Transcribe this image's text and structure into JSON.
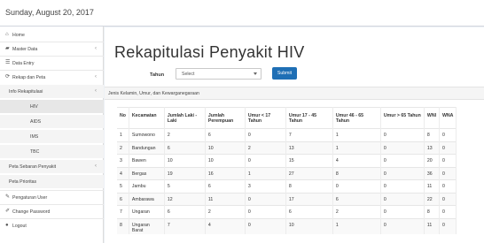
{
  "header": {
    "date": "Sunday, August 20, 2017"
  },
  "sidebar": {
    "items": [
      {
        "label": "Home",
        "icon": "home-icon"
      },
      {
        "label": "Master Data",
        "icon": "database-icon",
        "chevron": "‹"
      },
      {
        "label": "Data Entry",
        "icon": "list-icon"
      },
      {
        "label": "Rekap dan Peta",
        "icon": "refresh-icon",
        "chevron": "‹"
      },
      {
        "label": "Info Rekapitulasi",
        "chevron": "‹"
      },
      {
        "label": "HIV"
      },
      {
        "label": "AIDS"
      },
      {
        "label": "IMS"
      },
      {
        "label": "TBC"
      },
      {
        "label": "Peta Sebaran Penyakit",
        "chevron": "‹"
      },
      {
        "label": "Peta Prioritas"
      },
      {
        "label": "Pengaturan User",
        "icon": "wrench-icon"
      },
      {
        "label": "Change Password",
        "icon": "edit-icon"
      },
      {
        "label": "Logout",
        "icon": "user-icon"
      }
    ]
  },
  "main": {
    "title": "Rekapitulasi Penyakit HIV",
    "filter": {
      "label": "Tahun",
      "select_value": "Select",
      "submit_label": "Submit"
    },
    "panel_title": "Jenis Kelamin, Umur, dan Kewarganegaraan",
    "table": {
      "columns": [
        "No",
        "Kecamatan",
        "Jumlah Laki - Laki",
        "Jumlah Perempuan",
        "Umur < 17 Tahun",
        "Umur 17 - 45 Tahun",
        "Umur 46 - 65 Tahun",
        "Umur > 65 Tahun",
        "WNI",
        "WNA"
      ],
      "rows": [
        [
          "1",
          "Sumowono",
          "2",
          "6",
          "0",
          "7",
          "1",
          "0",
          "8",
          "0"
        ],
        [
          "2",
          "Bandungan",
          "6",
          "10",
          "2",
          "13",
          "1",
          "0",
          "13",
          "0"
        ],
        [
          "3",
          "Bawen",
          "10",
          "10",
          "0",
          "15",
          "4",
          "0",
          "20",
          "0"
        ],
        [
          "4",
          "Bergas",
          "19",
          "16",
          "1",
          "27",
          "8",
          "0",
          "36",
          "0"
        ],
        [
          "5",
          "Jambu",
          "5",
          "6",
          "3",
          "8",
          "0",
          "0",
          "11",
          "0"
        ],
        [
          "6",
          "Ambarawa",
          "12",
          "11",
          "0",
          "17",
          "6",
          "0",
          "22",
          "0"
        ],
        [
          "7",
          "Ungaran",
          "6",
          "2",
          "0",
          "6",
          "2",
          "0",
          "8",
          "0"
        ],
        [
          "8",
          "Ungaran Barat",
          "7",
          "4",
          "0",
          "10",
          "1",
          "0",
          "11",
          "0"
        ]
      ]
    }
  }
}
